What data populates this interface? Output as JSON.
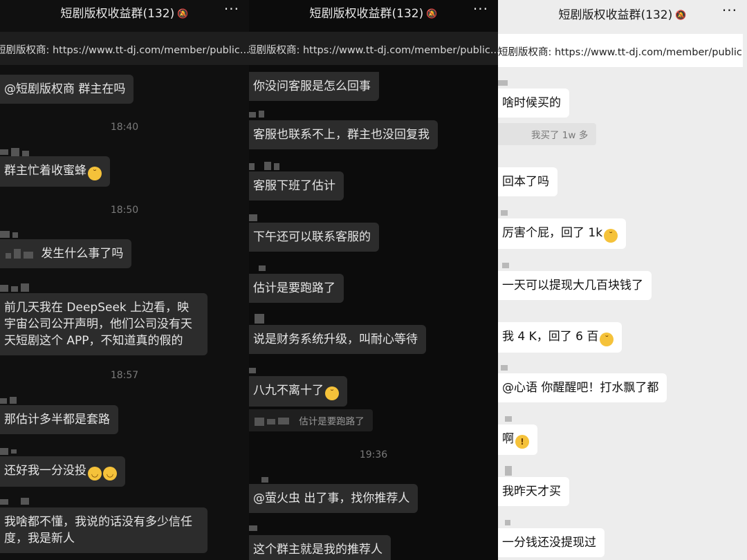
{
  "chat_title": "短剧版权收益群(132)",
  "pinned": "短剧版权商: https://www.tt-dj.com/member/public...",
  "icons": {
    "mute": "bell-slash-icon",
    "more": "more-dots-icon",
    "emoji": "emoji-icon"
  },
  "panel1": {
    "messages": [
      "@短剧版权商 群主在吗",
      "群主忙着收蜜蜂",
      "发生什么事了吗",
      "前几天我在 DeepSeek 上边看，映宇宙公司公开声明，他们公司没有天天短剧这个 APP，不知道真的假的",
      "那估计多半都是套路",
      "还好我一分没投",
      "我啥都不懂，我说的话没有多少信任度，我是新人"
    ],
    "times": [
      "18:40",
      "18:50",
      "18:57"
    ]
  },
  "panel2": {
    "messages": [
      "你没问客服是怎么回事",
      "客服也联系不上，群主也没回复我",
      "客服下班了估计",
      "下午还可以联系客服的",
      "估计是要跑路了",
      "说是财务系统升级，叫耐心等待",
      "八九不离十了",
      "@萤火虫 出了事，找你推荐人",
      "这个群主就是我的推荐人"
    ],
    "quote": "估计是要跑路了",
    "times": [
      "19:36"
    ]
  },
  "panel3": {
    "messages": [
      "啥时候买的",
      "回本了吗",
      "厉害个屁，回了 1k",
      "一天可以提现大几百块钱了",
      "我 4 K，回了 6 百",
      "@心语 你醒醒吧！打水飘了都",
      "啊",
      "我昨天才买",
      "一分钱还没提现过"
    ],
    "quote": "我买了 1w 多"
  }
}
